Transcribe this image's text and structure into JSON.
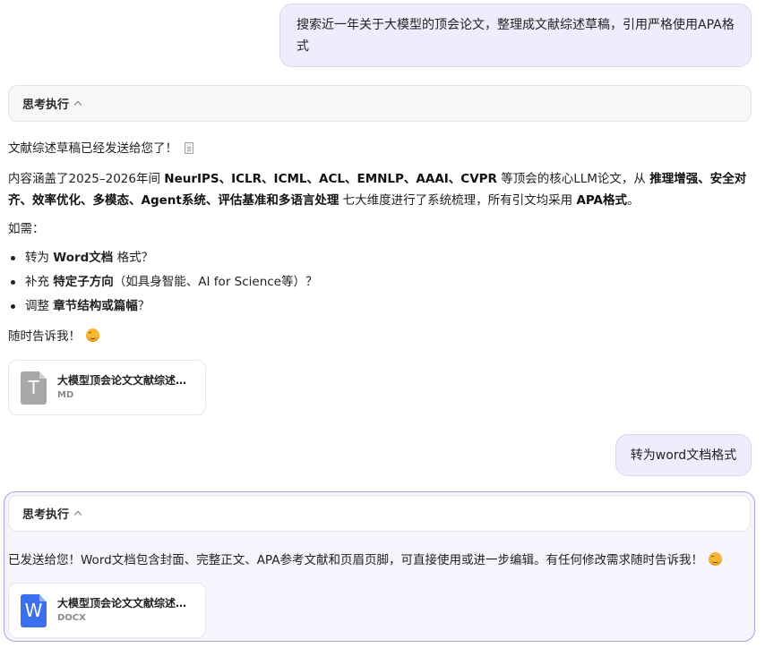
{
  "messages": {
    "user1": "搜索近一年关于大模型的顶会论文，整理成文献综述草稿，引用严格使用APA格式",
    "thinking_label": "思考执行",
    "reply1": {
      "line1": "文献综述草稿已经发送给您了！",
      "line2_a": "内容涵盖了2025–2026年间 ",
      "line2_b": "NeurIPS、ICLR、ICML、ACL、EMNLP、AAAI、CVPR",
      "line2_c": " 等顶会的核心LLM论文，从 ",
      "line2_d": "推理增强、安全对",
      "line3_a": "齐、效率优化、多模态、Agent系统、评估基准和多语言处理",
      "line3_b": " 七大维度进行了系统梳理，所有引文均采用 ",
      "line3_c": "APA格式",
      "line3_d": "。",
      "need_label": "如需：",
      "bullets": [
        {
          "pre": "转为 ",
          "bold": "Word文档",
          "post": " 格式？"
        },
        {
          "pre": "补充 ",
          "bold": "特定子方向",
          "post": "（如具身智能、AI for Science等）？"
        },
        {
          "pre": "调整 ",
          "bold": "章节结构或篇幅",
          "post": "？"
        }
      ],
      "closing": "随时告诉我！"
    },
    "file1": {
      "name": "大模型顶会论文文献综述草稿.md",
      "type": "MD",
      "glyph": "T",
      "color": "#a8a8a8"
    },
    "user2": "转为word文档格式",
    "reply2": {
      "text": "已发送给您！Word文档包含封面、完整正文、APA参考文献和页眉页脚，可直接使用或进一步编辑。有任何修改需求随时告诉我！"
    },
    "file2": {
      "name": "大模型顶会论文文献综述草稿.docx",
      "type": "DOCX",
      "glyph": "W",
      "color": "#3b6ff0"
    }
  }
}
